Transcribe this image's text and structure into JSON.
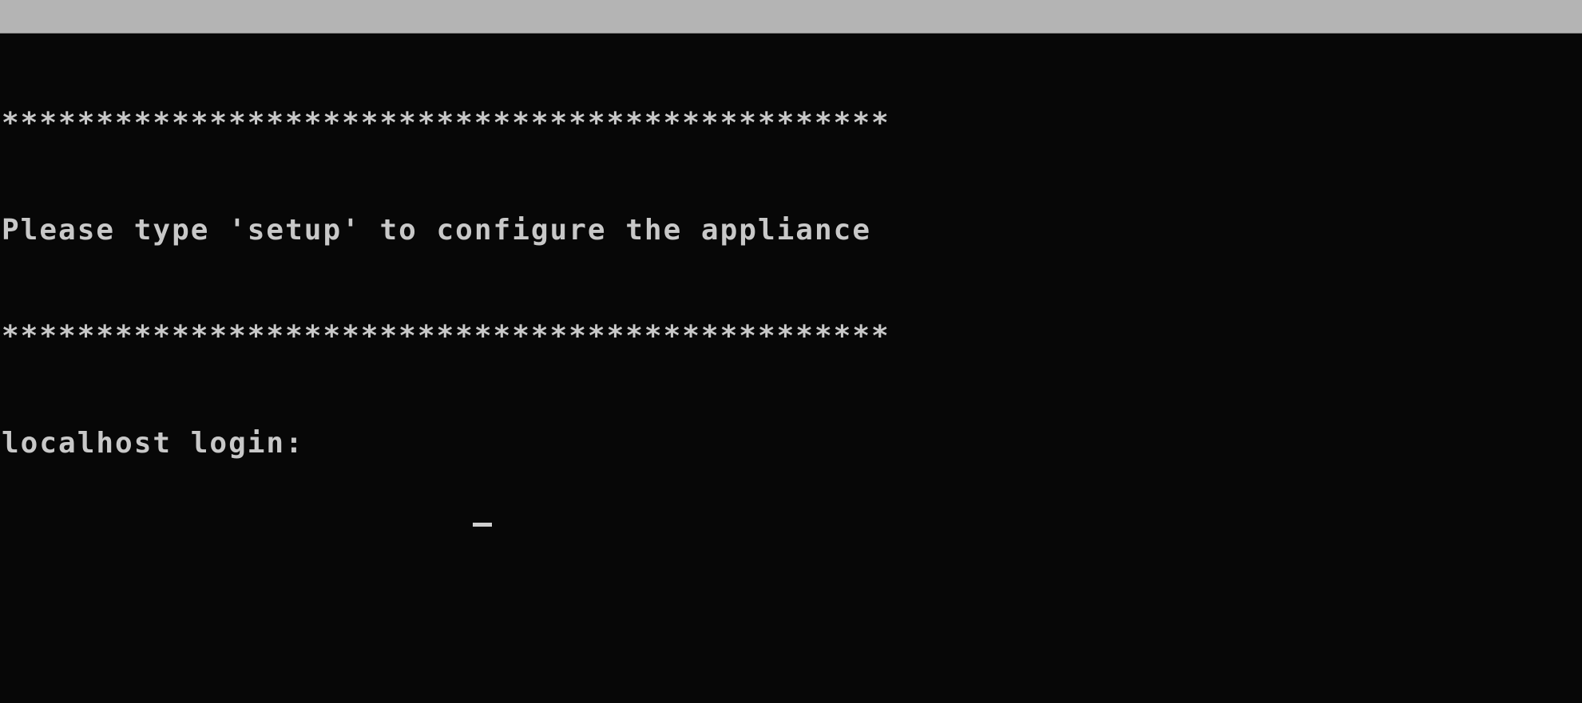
{
  "console": {
    "banner_top": "***********************************************",
    "message": "Please type 'setup' to configure the appliance",
    "banner_bottom": "***********************************************",
    "login_prompt": "localhost login:",
    "login_value": ""
  },
  "colors": {
    "background": "#070707",
    "text": "#c8c8c8",
    "top_bar": "#b4b4b4"
  }
}
